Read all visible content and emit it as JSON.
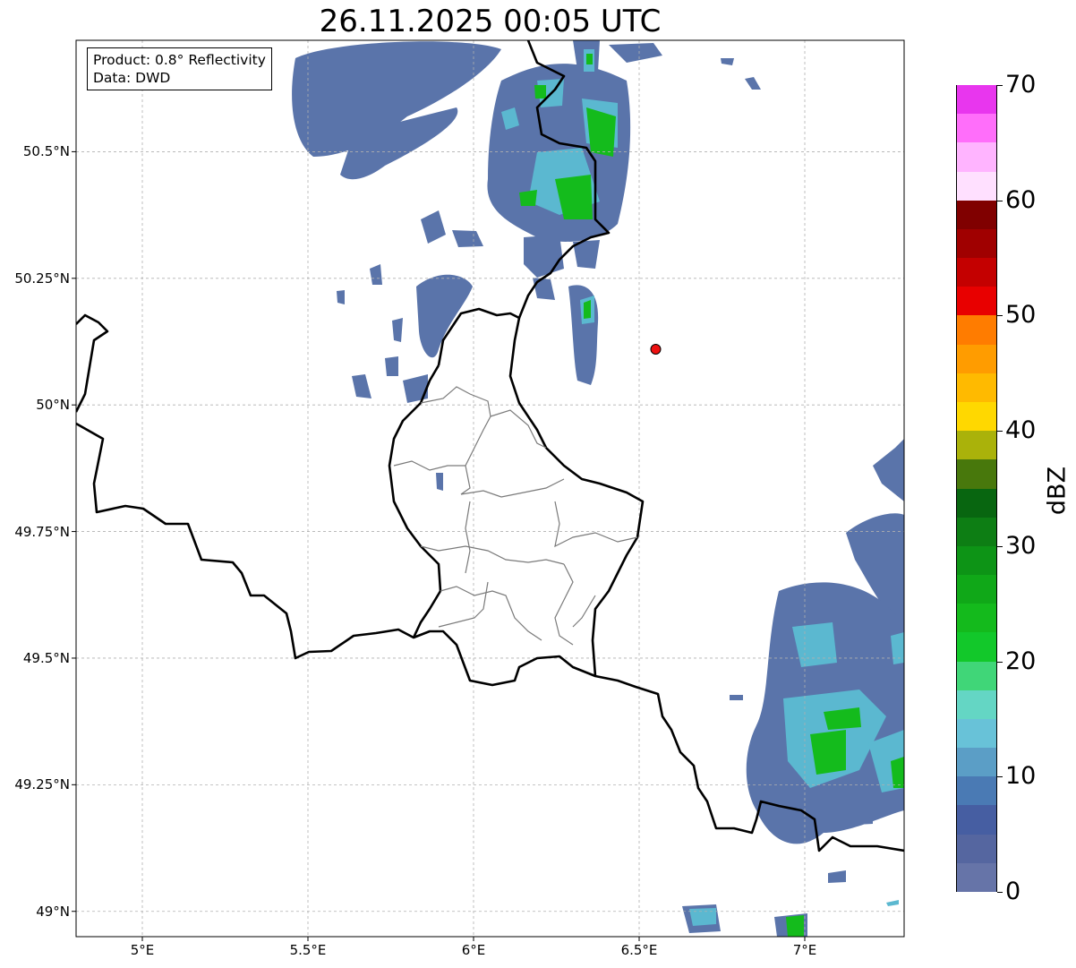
{
  "title": "26.11.2025 00:05 UTC",
  "info_box": {
    "product": "Product: 0.8° Reflectivity",
    "data": "Data: DWD"
  },
  "map": {
    "extent": {
      "lon": [
        4.8,
        7.3
      ],
      "lat": [
        48.95,
        50.72
      ]
    },
    "lat_ticks": [
      {
        "lat": 50.5,
        "label": "50.5°N"
      },
      {
        "lat": 50.25,
        "label": "50.25°N"
      },
      {
        "lat": 50.0,
        "label": "50°N"
      },
      {
        "lat": 49.75,
        "label": "49.75°N"
      },
      {
        "lat": 49.5,
        "label": "49.5°N"
      },
      {
        "lat": 49.25,
        "label": "49.25°N"
      },
      {
        "lat": 49.0,
        "label": "49°N"
      }
    ],
    "lon_ticks": [
      {
        "lon": 5.0,
        "label": "5°E"
      },
      {
        "lon": 5.5,
        "label": "5.5°E"
      },
      {
        "lon": 6.0,
        "label": "6°E"
      },
      {
        "lon": 6.5,
        "label": "6.5°E"
      },
      {
        "lon": 7.0,
        "label": "7°E"
      }
    ],
    "marker": {
      "lon": 6.55,
      "lat": 50.11,
      "color": "#ee1111"
    },
    "grid": true
  },
  "colorbar": {
    "label": "dBZ",
    "min": 0,
    "max": 70,
    "ticks": [
      "0",
      "10",
      "20",
      "30",
      "40",
      "50",
      "60",
      "70"
    ],
    "colors": [
      "#6674a8",
      "#5566a0",
      "#465ea2",
      "#4a7ab4",
      "#5b9ec6",
      "#68c2d8",
      "#64d6c4",
      "#40d678",
      "#12c82a",
      "#14ba1c",
      "#10a818",
      "#0d9416",
      "#0d7e14",
      "#086610",
      "#48780c",
      "#aab20a",
      "#ffd800",
      "#ffba00",
      "#ff9c00",
      "#ff7c00",
      "#e80000",
      "#c40000",
      "#a00000",
      "#800000",
      "#ffe0ff",
      "#ffb4ff",
      "#ff6efa",
      "#e836ee"
    ]
  }
}
